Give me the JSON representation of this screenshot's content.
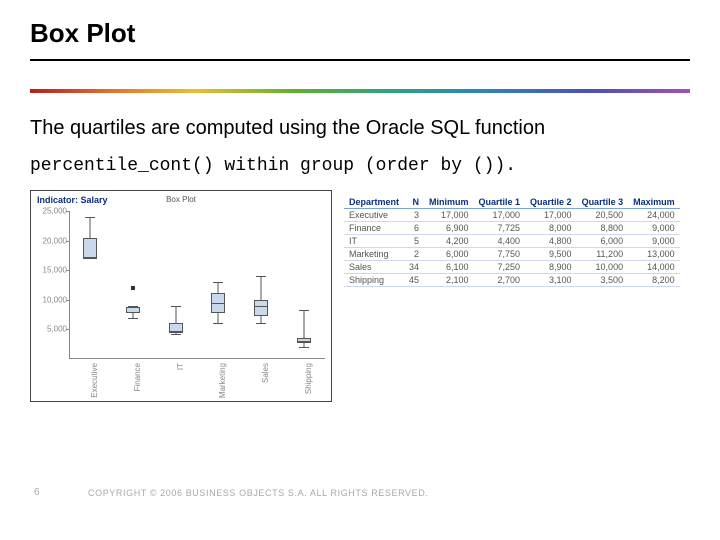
{
  "title": "Box Plot",
  "body": "The quartiles are computed using the Oracle SQL function",
  "code": "percentile_cont() within group (order by ()).",
  "footer": {
    "page": "6",
    "copyright": "COPYRIGHT © 2006 BUSINESS OBJECTS S.A.  ALL RIGHTS RESERVED."
  },
  "chart_data": {
    "type": "boxplot",
    "indicator_label": "Indicator: Salary",
    "title": "Box Plot",
    "ylabel": "",
    "ylim": [
      0,
      25000
    ],
    "yticks": [
      5000,
      10000,
      15000,
      20000,
      25000
    ],
    "categories": [
      "Executive",
      "Finance",
      "IT",
      "Marketing",
      "Sales",
      "Shipping"
    ],
    "series": [
      {
        "name": "Executive",
        "min": 17000,
        "q1": 17000,
        "median": 17000,
        "q3": 20500,
        "max": 24000,
        "outliers": []
      },
      {
        "name": "Finance",
        "min": 6900,
        "q1": 7725,
        "median": 8000,
        "q3": 8800,
        "max": 9000,
        "outliers": [
          12000
        ]
      },
      {
        "name": "IT",
        "min": 4200,
        "q1": 4400,
        "median": 4800,
        "q3": 6000,
        "max": 9000,
        "outliers": []
      },
      {
        "name": "Marketing",
        "min": 6000,
        "q1": 7750,
        "median": 9500,
        "q3": 11200,
        "max": 13000,
        "outliers": []
      },
      {
        "name": "Sales",
        "min": 6100,
        "q1": 7250,
        "median": 8900,
        "q3": 10000,
        "max": 14000,
        "outliers": []
      },
      {
        "name": "Shipping",
        "min": 2100,
        "q1": 2700,
        "median": 3100,
        "q3": 3500,
        "max": 8200,
        "outliers": []
      }
    ]
  },
  "table": {
    "headers": [
      "Department",
      "N",
      "Minimum",
      "Quartile 1",
      "Quartile 2",
      "Quartile 3",
      "Maximum"
    ],
    "rows": [
      [
        "Executive",
        "3",
        "17,000",
        "17,000",
        "17,000",
        "20,500",
        "24,000"
      ],
      [
        "Finance",
        "6",
        "6,900",
        "7,725",
        "8,000",
        "8,800",
        "9,000"
      ],
      [
        "IT",
        "5",
        "4,200",
        "4,400",
        "4,800",
        "6,000",
        "9,000"
      ],
      [
        "Marketing",
        "2",
        "6,000",
        "7,750",
        "9,500",
        "11,200",
        "13,000"
      ],
      [
        "Sales",
        "34",
        "6,100",
        "7,250",
        "8,900",
        "10,000",
        "14,000"
      ],
      [
        "Shipping",
        "45",
        "2,100",
        "2,700",
        "3,100",
        "3,500",
        "8,200"
      ]
    ]
  }
}
